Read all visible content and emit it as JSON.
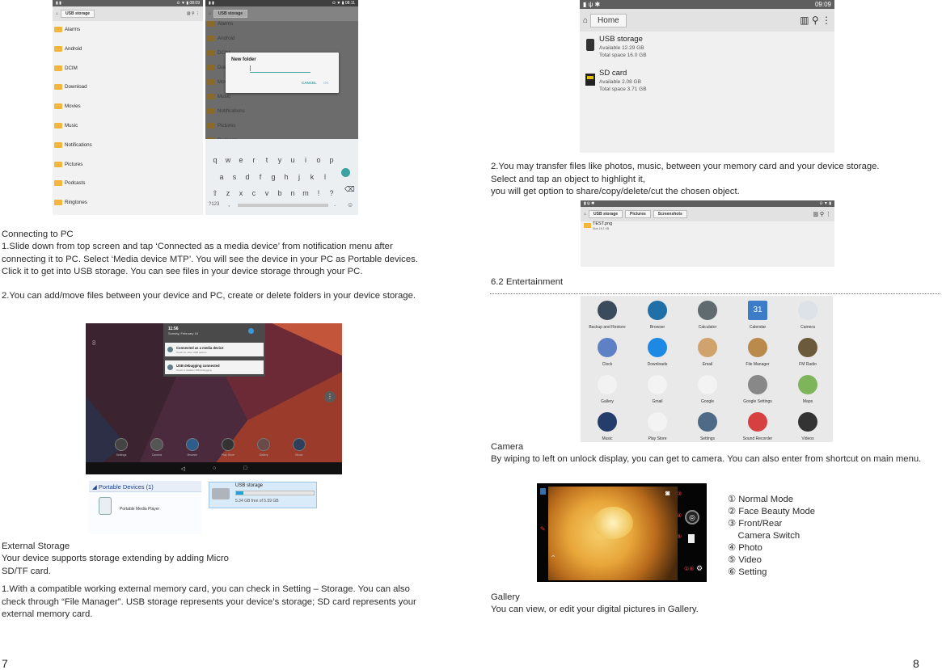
{
  "left": {
    "sc1": {
      "title": "USB storage",
      "folders": [
        "Alarms",
        "Android",
        "DCIM",
        "Download",
        "Movies",
        "Music",
        "Notifications",
        "Pictures",
        "Podcasts",
        "Ringtones"
      ]
    },
    "sc2": {
      "title": "USB storage",
      "folders": [
        "Alarms",
        "Android",
        "DCIM",
        "Download",
        "Movies",
        "Music",
        "Notifications",
        "Pictures",
        "Podcasts"
      ],
      "dialog_title": "New folder",
      "cancel": "CANCEL",
      "ok": "OK",
      "row1": [
        "q",
        "w",
        "e",
        "r",
        "t",
        "y",
        "u",
        "i",
        "o",
        "p"
      ],
      "row2": [
        "a",
        "s",
        "d",
        "f",
        "g",
        "h",
        "j",
        "k",
        "l"
      ],
      "row3": [
        "z",
        "x",
        "c",
        "v",
        "b",
        "n",
        "m",
        "!",
        "?"
      ],
      "row4": [
        "?123",
        ","
      ]
    },
    "connecting_title": "Connecting to PC",
    "connecting_p1": "1.Slide down from top screen and tap ‘Connected as a media device’ from notification menu after connecting it to PC. Select ‘Media device MTP’. You will see the device in your PC as Portable devices. Click it to get into USB storage. You can see files in your device storage through your PC.",
    "connecting_p2": "2.You can add/move files between your device and PC, create or delete folders in your device storage.",
    "notif": {
      "time": "11:56",
      "date": "Sunday, February 16",
      "n1_title": "Connected as a media device",
      "n1_sub": "Touch for other USB options.",
      "n2_title": "USB debugging connected",
      "n2_sub": "Touch to disable USB debugging.",
      "dock": [
        "Settings",
        "Camera",
        "Browser",
        "Play Store",
        "Gallery",
        "Music"
      ]
    },
    "pc": {
      "group": "Portable Devices (1)",
      "device": "Portable Media Player",
      "storage": "USB storage",
      "free": "5.34 GB free of 5.59 GB"
    },
    "ext_title": "External Storage",
    "ext_p1": "Your device supports storage extending by adding Micro SD/TF card.",
    "ext_p2": "1.With a compatible working external memory card, you can check in Setting – Storage. You can also check through “File Manager”. USB storage represents your device’s storage; SD card represents your external memory card.",
    "page_num": "7"
  },
  "right": {
    "home": {
      "time": "09:09",
      "crumb": "Home",
      "usb_name": "USB storage",
      "usb_avail": "Available 12.29 GB",
      "usb_total": "Total space 16.0 GB",
      "sd_name": "SD card",
      "sd_avail": "Available 2.08 GB",
      "sd_total": "Total space 3.71 GB"
    },
    "transfer_p": "2.You may transfer files like photos, music,  between your memory card and your device storage. Select and tap an object to highlight it,\nyou will get option to share/copy/delete/cut the chosen object.",
    "sel": {
      "c1": "USB storage",
      "c2": "Pictures",
      "c3": "Screenshots",
      "file": "TEST.png",
      "meta": "Size 18.1 KB"
    },
    "ent_title": "6.2 Entertainment",
    "apps": [
      "Backup and Restore",
      "Browser",
      "Calculator",
      "Calendar",
      "Camera",
      "Clock",
      "Downloads",
      "Email",
      "File Manager",
      "FM Radio",
      "Gallery",
      "Gmail",
      "Google",
      "Google Settings",
      "Maps",
      "Music",
      "Play Store",
      "Settings",
      "Sound Recorder",
      "Videos"
    ],
    "calendar_day": "31",
    "camera_title": "Camera",
    "camera_p": "By wiping to left on unlock display, you can get to camera. You can also enter from shortcut on main menu.",
    "legend": [
      "① Normal Mode",
      "② Face Beauty Mode",
      "③ Front/Rear",
      "    Camera Switch",
      "④ Photo",
      "⑤ Video",
      "⑥ Setting"
    ],
    "cam_marks": [
      "②",
      "③",
      "④",
      "⑤",
      "①⑥"
    ],
    "gallery_title": "Gallery",
    "gallery_p": "You can view, or edit your digital pictures in Gallery.",
    "page_num": "8"
  },
  "colors": {
    "folder": "#f4b63c",
    "bar": "#5e5e5e",
    "accent": "#2e8bd9"
  }
}
